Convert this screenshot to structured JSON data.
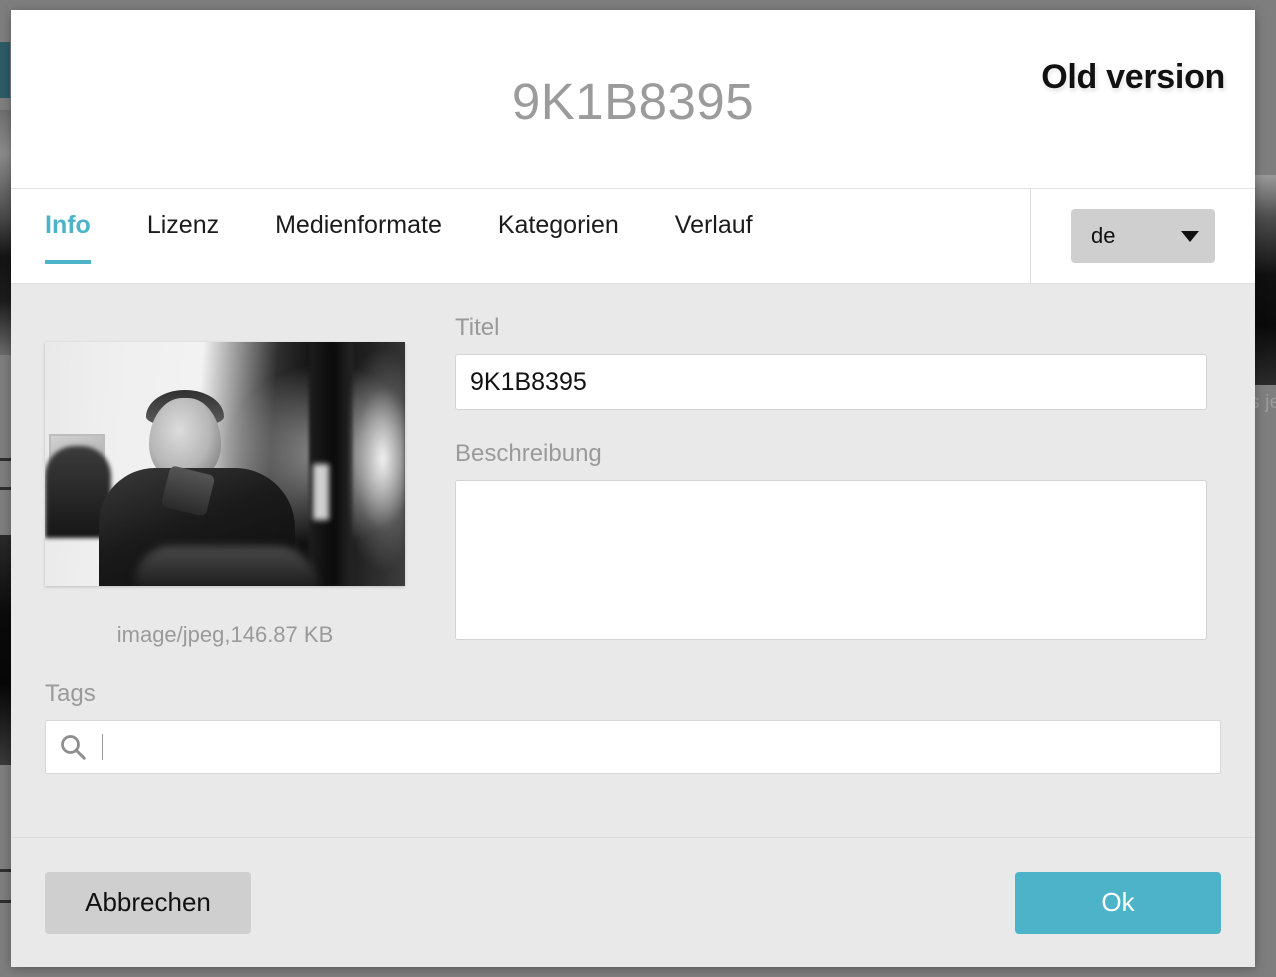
{
  "backdrop": {
    "right_text_fragments": "s\nje"
  },
  "modal": {
    "header": {
      "title": "9K1B8395",
      "badge": "Old version"
    },
    "tabs": [
      {
        "label": "Info",
        "active": true
      },
      {
        "label": "Lizenz",
        "active": false
      },
      {
        "label": "Medienformate",
        "active": false
      },
      {
        "label": "Kategorien",
        "active": false
      },
      {
        "label": "Verlauf",
        "active": false
      }
    ],
    "language_select": {
      "value": "de",
      "icon": "chevron-down-icon"
    },
    "preview": {
      "file_meta": "image/jpeg,146.87 KB",
      "alt": "black and white photo of a smiling man"
    },
    "fields": {
      "title": {
        "label": "Titel",
        "value": "9K1B8395",
        "placeholder": ""
      },
      "description": {
        "label": "Beschreibung",
        "value": "",
        "placeholder": ""
      },
      "tags": {
        "label": "Tags",
        "value": "",
        "placeholder": "",
        "icon": "search-icon"
      }
    },
    "footer": {
      "cancel_label": "Abbrechen",
      "ok_label": "Ok"
    }
  },
  "colors": {
    "accent_teal": "#4db3c8",
    "backdrop_gray": "#7e7e7e",
    "body_gray": "#e9e9e9",
    "label_gray": "#9a9a9a",
    "button_gray": "#cfcfcf",
    "bg_dark_teal": "#2c5b66"
  }
}
